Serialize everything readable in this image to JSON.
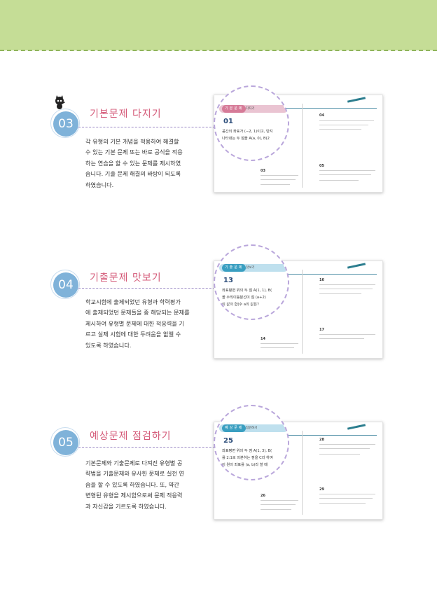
{
  "sections": [
    {
      "number": "03",
      "title": "기본문제 다지기",
      "body": [
        "각 유형의 기본 개념을 적용하여 해결할",
        "수 있는 기본 문제 또는 바로 공식을 적용",
        "하는 연습을 할 수 있는 문제를 제시하였",
        "습니다. 기출 문제 해결의 바탕이 되도록",
        "하였습니다."
      ],
      "lens": {
        "tag": "기본문제",
        "tag_sub": "다지기",
        "qnum": "01",
        "lines": [
          "공간의 좌표가 (−2, 1)이고, 반지",
          "나타내는 두 점을 A(a, 0), B(2"
        ]
      },
      "card_questions": [
        "04",
        "05",
        "03"
      ]
    },
    {
      "number": "04",
      "title": "기출문제 맛보기",
      "body": [
        "학교시험에 출제되었던 유형과 학력평가",
        "에 출제되었던 문제들을 중 해당되는 문제를",
        "제시하여 유형별 문제에 대한 적응력을 기",
        "르고 실제 시험에 대한 두려움을 없앨 수",
        "있도록 하였습니다."
      ],
      "lens": {
        "tag": "기출문제",
        "tag_sub": "맛보기",
        "qnum": "13",
        "lines": [
          "좌표평면 위의 두 점 A(1, 1), B(",
          "을 수직이등분선이 점 (a+2)",
          "의 값의 합(수 a의 값은?"
        ]
      },
      "card_questions": [
        "16",
        "17",
        "14"
      ]
    },
    {
      "number": "05",
      "title": "예상문제 점검하기",
      "body": [
        "기본문제와 기출문제로 다져진 유형별 공",
        "략법을 기출문제와 유사한 문제로 실전 연",
        "습을 할 수 있도록 하였습니다. 또, 약간",
        "변형된 유형을 제시함으로써 문제 적응력",
        "과 자신감을 기르도록 하였습니다."
      ],
      "lens": {
        "tag": "예상문제",
        "tag_sub": "점검하기",
        "qnum": "25",
        "lines": [
          "좌표평면 위의 두 점 A(1, 3), B(",
          "를 2:1로 외분하는 점을 C라 하여",
          "이 원의 좌표를 (a, b)라 할 때"
        ]
      },
      "card_questions": [
        "28",
        "29",
        "26"
      ]
    }
  ],
  "colors": {
    "band": "#c5dd96",
    "title": "#d45a78",
    "circle": "#7fb2d9",
    "tag1": "#d67b98",
    "tag2": "#3a9fc1",
    "tag3": "#3a9fc1"
  }
}
